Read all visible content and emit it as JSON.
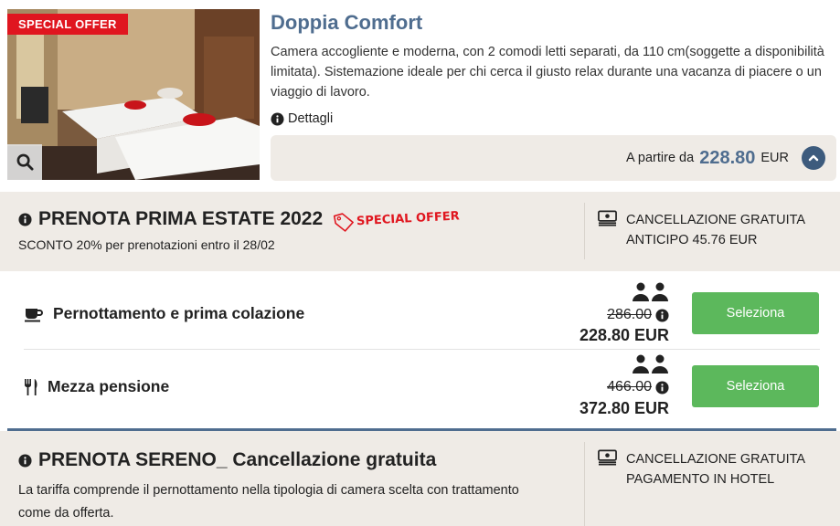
{
  "room": {
    "badge": "SPECIAL OFFER",
    "title": "Doppia Comfort",
    "description": "Camera accogliente e moderna, con 2 comodi letti separati, da 110 cm(soggette a disponibilità limitata). Sistemazione ideale per chi cerca il giusto relax durante una vacanza di piacere o un viaggio di lavoro.",
    "details_label": "Dettagli",
    "price_prefix": "A partire da",
    "price_value": "228.80",
    "price_currency": "EUR"
  },
  "offers": [
    {
      "title": "PRENOTA PRIMA ESTATE 2022",
      "tag": "SPECIAL OFFER",
      "subtitle": "SCONTO 20% per prenotazioni entro il 28/02",
      "policy_line1": "CANCELLAZIONE GRATUITA",
      "policy_line2": "ANTICIPO 45.76 EUR"
    },
    {
      "title": "PRENOTA SERENO_ Cancellazione gratuita",
      "subtitle_line1": "La tariffa comprende il pernottamento nella tipologia di camera scelta con trattamento",
      "subtitle_line2": "come da offerta.",
      "policy_line1": "CANCELLAZIONE GRATUITA",
      "policy_line2": "PAGAMENTO IN HOTEL"
    }
  ],
  "rates": [
    {
      "name": "Pernottamento e prima colazione",
      "icon": "coffee-cup-icon",
      "old_price": "286.00",
      "new_price": "228.80 EUR",
      "button": "Seleziona"
    },
    {
      "name": "Mezza pensione",
      "icon": "fork-knife-icon",
      "old_price": "466.00",
      "new_price": "372.80 EUR",
      "button": "Seleziona"
    }
  ],
  "colors": {
    "brand_blue": "#4f6d8f",
    "ribbon_red": "#e0161f",
    "select_green": "#5cb85c",
    "section_bg": "#efebe6"
  }
}
